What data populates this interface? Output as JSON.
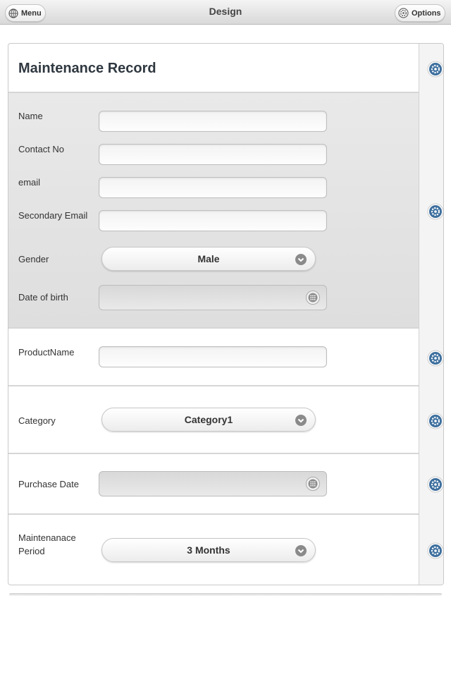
{
  "topbar": {
    "title": "Design",
    "menu_label": "Menu",
    "options_label": "Options",
    "menu_icon": "globe-icon",
    "options_icon": "gear-icon"
  },
  "form": {
    "heading": "Maintenance Record",
    "contact": {
      "name_label": "Name",
      "name_value": "",
      "contact_label": "Contact No",
      "contact_value": "",
      "email_label": "email",
      "email_value": "",
      "secondary_email_label": "Secondary Email",
      "secondary_email_value": "",
      "gender_label": "Gender",
      "gender_value": "Male",
      "dob_label": "Date of birth",
      "dob_value": ""
    },
    "product": {
      "label": "ProductName",
      "value": ""
    },
    "category": {
      "label": "Category",
      "value": "Category1"
    },
    "purchase": {
      "label": "Purchase Date",
      "value": ""
    },
    "period": {
      "label_line1": "Maintenanace",
      "label_line2": "Period",
      "value": "3 Months"
    }
  },
  "colors": {
    "gear_blue": "#3d6f9e",
    "section_gray": "#e6e6e6"
  }
}
